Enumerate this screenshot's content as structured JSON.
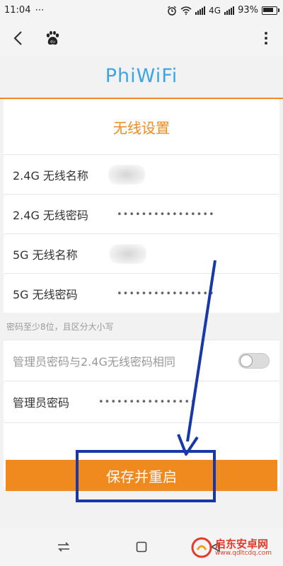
{
  "status_bar": {
    "time": "11:04",
    "dots": "⋯",
    "network": "4G",
    "battery": "93%",
    "battery_level": 0.93
  },
  "toolbar": {
    "back_icon": "chevron-left-icon",
    "paw_icon": "baidu-paw-icon",
    "menu_icon": "more-vertical-icon"
  },
  "logo": {
    "text": "PhiWiFi",
    "color": "#3aa6e3"
  },
  "page": {
    "title": "无线设置",
    "accent": "#f08a1e"
  },
  "fields": [
    {
      "label": "2.4G 无线名称",
      "value": ""
    },
    {
      "label": "2.4G 无线密码",
      "value": "••••••••••••••••"
    },
    {
      "label": "5G 无线名称",
      "value": ""
    },
    {
      "label": "5G 无线密码",
      "value": "••••••••••••••••"
    }
  ],
  "hint": "密码至少8位，且区分大小写",
  "admin_same": {
    "label": "管理员密码与2.4G无线密码相同",
    "enabled": false
  },
  "admin_password": {
    "label": "管理员密码",
    "value": "••••••••••••••••"
  },
  "save_button": {
    "label": "保存并重启"
  },
  "annotation": {
    "color": "#1838a8"
  },
  "nav_bar": {
    "icons": [
      "recents-switch-icon",
      "home-square-icon",
      "back-triangle-icon"
    ]
  },
  "watermark": {
    "title": "启东安卓网",
    "url": "www.qdltcdq.com"
  }
}
